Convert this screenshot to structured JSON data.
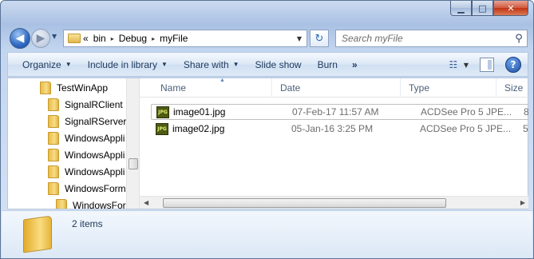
{
  "window": {
    "caption_buttons": {
      "minimize": "▁",
      "maximize": "□",
      "close": "✕"
    }
  },
  "navigation": {
    "back_glyph": "◀",
    "forward_glyph": "▶"
  },
  "address": {
    "overflow": "«",
    "crumbs": [
      "bin",
      "Debug",
      "myFile"
    ],
    "separator": "▸",
    "refresh_glyph": "↻"
  },
  "search": {
    "placeholder": "Search myFile",
    "icon": "search-icon"
  },
  "toolbar": {
    "organize": "Organize",
    "include_in_library": "Include in library",
    "share_with": "Share with",
    "slide_show": "Slide show",
    "burn": "Burn",
    "more": "»",
    "help": "?"
  },
  "tree": {
    "items": [
      {
        "label": "TestWinApp",
        "indent": 0
      },
      {
        "label": "SignalRClient",
        "indent": 1
      },
      {
        "label": "SignalRServer",
        "indent": 1
      },
      {
        "label": "WindowsAppli",
        "indent": 1
      },
      {
        "label": "WindowsAppli",
        "indent": 1
      },
      {
        "label": "WindowsAppli",
        "indent": 1
      },
      {
        "label": "WindowsForm",
        "indent": 1
      },
      {
        "label": "WindowsFor",
        "indent": 2
      }
    ]
  },
  "columns": {
    "name": "Name",
    "date": "Date",
    "type": "Type",
    "size": "Size"
  },
  "files": [
    {
      "name": "image01.jpg",
      "date": "07-Feb-17 11:57 AM",
      "type": "ACDSee Pro 5 JPE...",
      "size": "8",
      "icon_text": "JPG",
      "selected": true
    },
    {
      "name": "image02.jpg",
      "date": "05-Jan-16 3:25 PM",
      "type": "ACDSee Pro 5 JPE...",
      "size": "5",
      "icon_text": "JPG",
      "selected": false
    }
  ],
  "details": {
    "item_count": "2 items"
  },
  "colors": {
    "accent": "#1e395b",
    "selection_border": "#c0c0c0",
    "folder_yellow": "#f3cf6a"
  }
}
